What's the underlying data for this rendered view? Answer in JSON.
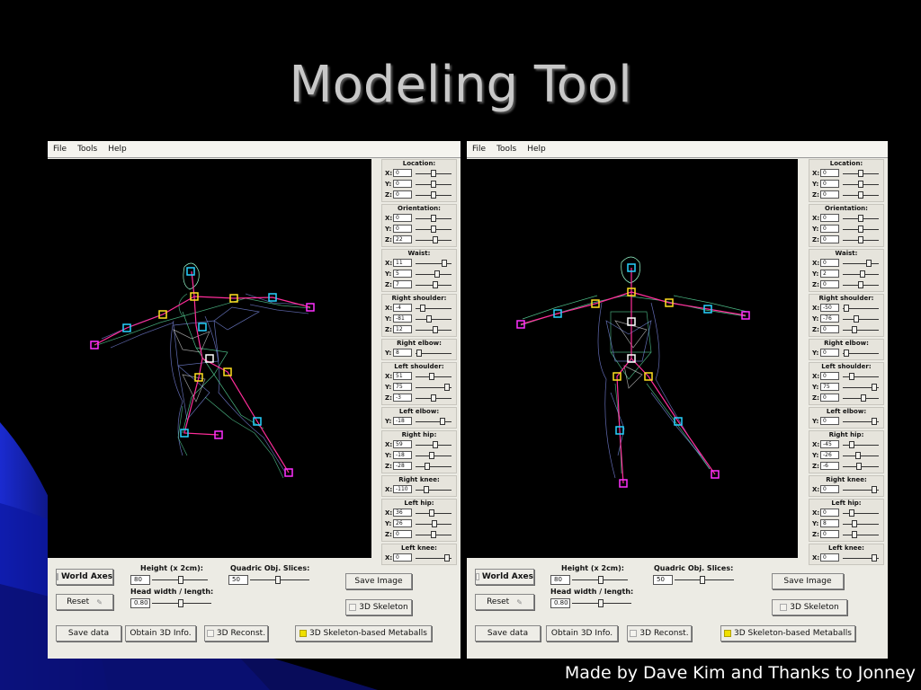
{
  "slide": {
    "title": "Modeling Tool",
    "footer": "Made by Dave Kim and Thanks to Jonney"
  },
  "colors": {
    "background": "#000000",
    "window_bg": "#ecebe4",
    "mesh_green": "#5fe8a8",
    "mesh_blue": "#7a86e0",
    "bone_magenta": "#ff2d9a",
    "joint_cyan": "#27d3ff",
    "joint_yellow": "#ffe020",
    "joint_magenta": "#ff30ff"
  },
  "icons": [
    "checkbox-icon",
    "reset-pencil-icon"
  ],
  "windows": [
    {
      "menu": [
        "File",
        "Tools",
        "Help"
      ],
      "panel": [
        {
          "title": "Location:",
          "rows": [
            {
              "axis": "X:",
              "value": "0",
              "pos": 0.5
            },
            {
              "axis": "Y:",
              "value": "0",
              "pos": 0.5
            },
            {
              "axis": "Z:",
              "value": "0",
              "pos": 0.5
            }
          ]
        },
        {
          "title": "Orientation:",
          "rows": [
            {
              "axis": "X:",
              "value": "0",
              "pos": 0.5
            },
            {
              "axis": "Y:",
              "value": "0",
              "pos": 0.5
            },
            {
              "axis": "Z:",
              "value": "22",
              "pos": 0.56
            }
          ]
        },
        {
          "title": "Waist:",
          "rows": [
            {
              "axis": "X:",
              "value": "11",
              "pos": 0.85
            },
            {
              "axis": "Y:",
              "value": "5",
              "pos": 0.62
            },
            {
              "axis": "Z:",
              "value": "7",
              "pos": 0.55
            }
          ]
        },
        {
          "title": "Right shoulder:",
          "rows": [
            {
              "axis": "X:",
              "value": "-4",
              "pos": 0.15
            },
            {
              "axis": "Y:",
              "value": "-81",
              "pos": 0.35
            },
            {
              "axis": "Z:",
              "value": "12",
              "pos": 0.55
            }
          ]
        },
        {
          "title": "Right elbow:",
          "rows": [
            {
              "axis": "Y:",
              "value": "8",
              "pos": 0.02
            }
          ]
        },
        {
          "title": "Left shoulder:",
          "rows": [
            {
              "axis": "X:",
              "value": "51",
              "pos": 0.45
            },
            {
              "axis": "Y:",
              "value": "75",
              "pos": 0.95
            },
            {
              "axis": "Z:",
              "value": "-3",
              "pos": 0.5
            }
          ]
        },
        {
          "title": "Left elbow:",
          "rows": [
            {
              "axis": "Y:",
              "value": "-18",
              "pos": 0.8
            }
          ]
        },
        {
          "title": "Right hip:",
          "rows": [
            {
              "axis": "X:",
              "value": "59",
              "pos": 0.55
            },
            {
              "axis": "Y:",
              "value": "-18",
              "pos": 0.45
            },
            {
              "axis": "Z:",
              "value": "-28",
              "pos": 0.3
            }
          ]
        },
        {
          "title": "Right knee:",
          "rows": [
            {
              "axis": "X:",
              "value": "-110",
              "pos": 0.25
            }
          ]
        },
        {
          "title": "Left hip:",
          "rows": [
            {
              "axis": "X:",
              "value": "36",
              "pos": 0.45
            },
            {
              "axis": "Y:",
              "value": "26",
              "pos": 0.52
            },
            {
              "axis": "Z:",
              "value": "0",
              "pos": 0.5
            }
          ]
        },
        {
          "title": "Left knee:",
          "rows": [
            {
              "axis": "X:",
              "value": "0",
              "pos": 0.95
            }
          ]
        }
      ],
      "controls": {
        "world_axes": "World Axes",
        "reset": "Reset",
        "height_label": "Height (x 2cm):",
        "height_value": "80",
        "head_label": "Head width / length:",
        "head_value": "0.80",
        "quadric_label": "Quadric Obj. Slices:",
        "quadric_value": "50",
        "save_image": "Save Image",
        "skeleton_3d": "3D Skeleton",
        "save_data": "Save data",
        "obtain_info": "Obtain 3D Info.",
        "reconst": "3D Reconst.",
        "metaballs": "3D Skeleton-based Metaballs"
      }
    },
    {
      "menu": [
        "File",
        "Tools",
        "Help"
      ],
      "panel": [
        {
          "title": "Location:",
          "rows": [
            {
              "axis": "X:",
              "value": "0",
              "pos": 0.5
            },
            {
              "axis": "Y:",
              "value": "0",
              "pos": 0.5
            },
            {
              "axis": "Z:",
              "value": "0",
              "pos": 0.5
            }
          ]
        },
        {
          "title": "Orientation:",
          "rows": [
            {
              "axis": "X:",
              "value": "0",
              "pos": 0.5
            },
            {
              "axis": "Y:",
              "value": "0",
              "pos": 0.5
            },
            {
              "axis": "Z:",
              "value": "0",
              "pos": 0.5
            }
          ]
        },
        {
          "title": "Waist:",
          "rows": [
            {
              "axis": "X:",
              "value": "0",
              "pos": 0.75
            },
            {
              "axis": "Y:",
              "value": "2",
              "pos": 0.55
            },
            {
              "axis": "Z:",
              "value": "0",
              "pos": 0.5
            }
          ]
        },
        {
          "title": "Right shoulder:",
          "rows": [
            {
              "axis": "X:",
              "value": "-50",
              "pos": 0.02
            },
            {
              "axis": "Y:",
              "value": "-76",
              "pos": 0.35
            },
            {
              "axis": "Z:",
              "value": "0",
              "pos": 0.3
            }
          ]
        },
        {
          "title": "Right elbow:",
          "rows": [
            {
              "axis": "Y:",
              "value": "0",
              "pos": 0.02
            }
          ]
        },
        {
          "title": "Left shoulder:",
          "rows": [
            {
              "axis": "X:",
              "value": "0",
              "pos": 0.2
            },
            {
              "axis": "Y:",
              "value": "75",
              "pos": 0.95
            },
            {
              "axis": "Z:",
              "value": "0",
              "pos": 0.6
            }
          ]
        },
        {
          "title": "Left elbow:",
          "rows": [
            {
              "axis": "Y:",
              "value": "0",
              "pos": 0.95
            }
          ]
        },
        {
          "title": "Right hip:",
          "rows": [
            {
              "axis": "X:",
              "value": "-45",
              "pos": 0.2
            },
            {
              "axis": "Y:",
              "value": "-26",
              "pos": 0.4
            },
            {
              "axis": "Z:",
              "value": "-6",
              "pos": 0.45
            }
          ]
        },
        {
          "title": "Right knee:",
          "rows": [
            {
              "axis": "X:",
              "value": "0",
              "pos": 0.95
            }
          ]
        },
        {
          "title": "Left hip:",
          "rows": [
            {
              "axis": "X:",
              "value": "0",
              "pos": 0.2
            },
            {
              "axis": "Y:",
              "value": "8",
              "pos": 0.3
            },
            {
              "axis": "Z:",
              "value": "0",
              "pos": 0.3
            }
          ]
        },
        {
          "title": "Left knee:",
          "rows": [
            {
              "axis": "X:",
              "value": "0",
              "pos": 0.95
            }
          ]
        }
      ],
      "controls": {
        "world_axes": "World Axes",
        "reset": "Reset",
        "height_label": "Height (x 2cm):",
        "height_value": "80",
        "head_label": "Head width / length:",
        "head_value": "0.80",
        "quadric_label": "Quadric Obj. Slices:",
        "quadric_value": "50",
        "save_image": "Save Image",
        "skeleton_3d": "3D Skeleton",
        "save_data": "Save data",
        "obtain_info": "Obtain 3D Info.",
        "reconst": "3D Reconst.",
        "metaballs": "3D Skeleton-based Metaballs"
      }
    }
  ]
}
